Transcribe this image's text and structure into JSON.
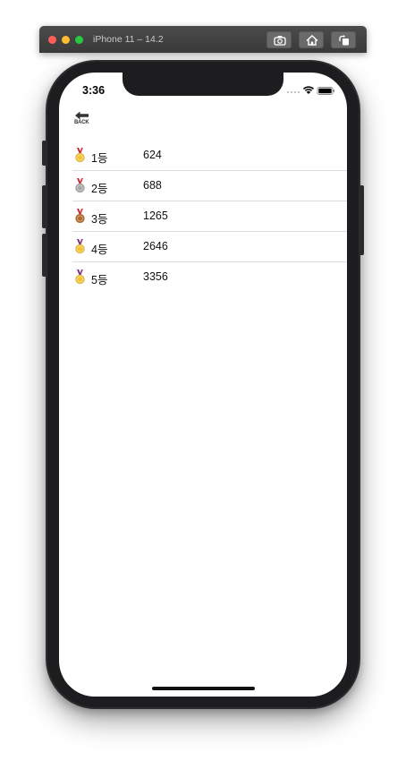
{
  "simulator": {
    "title": "iPhone 11 – 14.2",
    "buttons": [
      "screenshot-icon",
      "home-icon",
      "rotate-icon"
    ]
  },
  "status_bar": {
    "time": "3:36"
  },
  "nav": {
    "back_label": "BACK"
  },
  "scores": [
    {
      "rank": "1등",
      "score": "624",
      "medal": "gold-medal-icon",
      "medal_color": "#f2c230",
      "ribbon_color": "#c8262c"
    },
    {
      "rank": "2등",
      "score": "688",
      "medal": "silver-medal-icon",
      "medal_color": "#a7a7a7",
      "ribbon_color": "#c8262c"
    },
    {
      "rank": "3등",
      "score": "1265",
      "medal": "bronze-medal-icon",
      "medal_color": "#b06a2c",
      "ribbon_color": "#c8262c"
    },
    {
      "rank": "4등",
      "score": "2646",
      "medal": "sports-medal-icon",
      "medal_color": "#f2c230",
      "ribbon_color": "#7a2e7a"
    },
    {
      "rank": "5등",
      "score": "3356",
      "medal": "sports-medal-icon",
      "medal_color": "#f2c230",
      "ribbon_color": "#7a2e7a"
    }
  ],
  "colors": {
    "toolbar": "#3f3f3f",
    "device": "#1d1d1f",
    "divider": "#dcdcdc"
  }
}
